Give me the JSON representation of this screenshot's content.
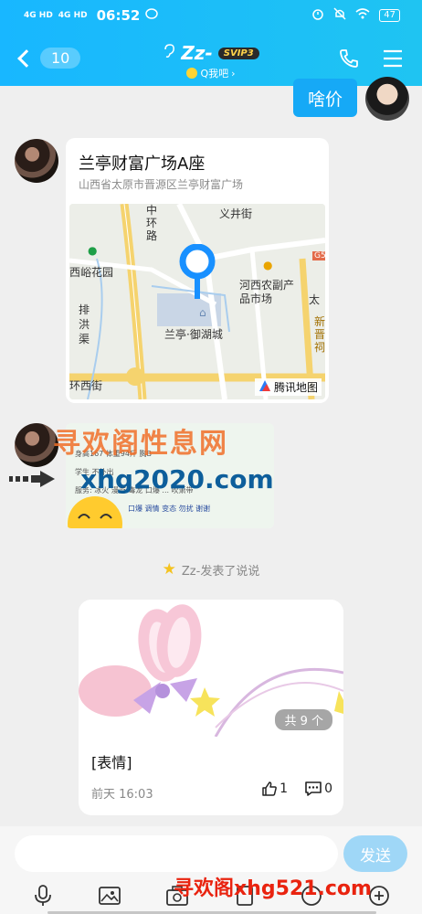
{
  "status_bar": {
    "signal_1": "4G HD",
    "signal_2": "4G HD",
    "time": "06:52",
    "battery": "47"
  },
  "header": {
    "unread_count": "10",
    "contact_name": "Zz-",
    "vip_badge": "SVIP3",
    "subtitle": "Q我吧",
    "subtitle_arrow": "›"
  },
  "messages": {
    "sent_text": "啥价",
    "location": {
      "title": "兰亭财富广场A座",
      "address": "山西省太原市晋源区兰亭财富广场",
      "map_labels": {
        "yijing_street": "义井街",
        "zhonghuan_road": "中环路",
        "xiyu_garden": "西峪花园",
        "paihong_canal": "排洪渠",
        "hexi_market": "河西农副产品市场",
        "lanting_yuhu": "兰亭·御湖城",
        "huan_xijie": "环西街",
        "tai": "太",
        "xinjin": "新晋祠",
        "g5": "G5"
      },
      "map_brand": "腾讯地图"
    },
    "image_text_lines": {
      "l1": "身高167 体重94斤 胸B",
      "l2": "学生 不外出",
      "l3": "服务: 冰火 漫游 毒龙 口爆 ... 吹箫带",
      "l4": "口爆 调情 变态 勿扰 谢谢"
    }
  },
  "watermarks": {
    "w1": "寻欢阁性息网",
    "w2": "xhg2020.com",
    "w3": "寻欢阁xhg521.com"
  },
  "system_note": "Zz-发表了说说",
  "moment": {
    "photo_count": "共 9 个",
    "text": "[表情]",
    "time": "前天 16:03",
    "likes": "1",
    "comments": "0"
  },
  "input": {
    "placeholder": "",
    "send_label": "发送"
  },
  "colors": {
    "header_blue": "#18b7ff",
    "bubble_blue": "#16a9f6",
    "send_disabled": "#9fd7f7",
    "background": "#efefef"
  },
  "icons": {
    "back": "chevron-left-icon",
    "phone": "phone-icon",
    "menu": "menu-icon",
    "star": "star-icon",
    "like": "thumb-up-icon",
    "comment": "comment-icon",
    "voice": "microphone-icon",
    "image": "image-icon",
    "camera": "camera-icon",
    "plus": "plus-icon"
  }
}
